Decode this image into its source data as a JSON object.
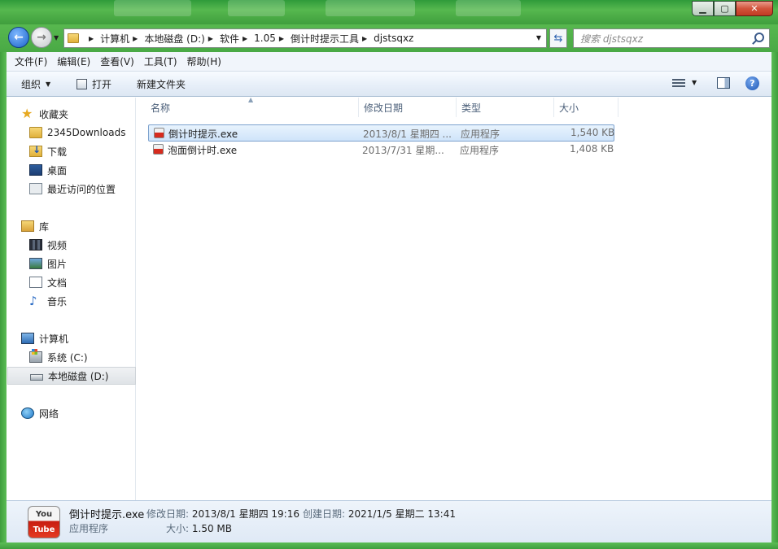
{
  "window": {
    "controls": {
      "minimize": "▁",
      "maximize": "▢",
      "close": "✕"
    }
  },
  "address": {
    "breadcrumbs": [
      "计算机",
      "本地磁盘 (D:)",
      "软件",
      "1.05",
      "倒计时提示工具",
      "djstsqxz"
    ],
    "search_placeholder": "搜索 djstsqxz"
  },
  "menu": [
    "文件(F)",
    "编辑(E)",
    "查看(V)",
    "工具(T)",
    "帮助(H)"
  ],
  "commands": {
    "organize": "组织",
    "open": "打开",
    "new_folder": "新建文件夹",
    "help": "?"
  },
  "nav": {
    "favorites": {
      "label": "收藏夹",
      "items": [
        "2345Downloads",
        "下载",
        "桌面",
        "最近访问的位置"
      ]
    },
    "libraries": {
      "label": "库",
      "items": [
        "视频",
        "图片",
        "文档",
        "音乐"
      ]
    },
    "computer": {
      "label": "计算机",
      "items": [
        "系统 (C:)",
        "本地磁盘 (D:)"
      ],
      "selected": "本地磁盘 (D:)"
    },
    "network": {
      "label": "网络"
    }
  },
  "columns": {
    "name": "名称",
    "modified": "修改日期",
    "type": "类型",
    "size": "大小"
  },
  "files": [
    {
      "name": "倒计时提示.exe",
      "modified": "2013/8/1 星期四 ...",
      "type": "应用程序",
      "size": "1,540 KB",
      "selected": true,
      "icon": "youtube-exe-icon"
    },
    {
      "name": "泡面倒计时.exe",
      "modified": "2013/7/31 星期...",
      "type": "应用程序",
      "size": "1,408 KB",
      "selected": false,
      "icon": "youtube-exe-icon"
    }
  ],
  "details": {
    "icon_text_top": "You",
    "icon_text_bottom": "Tube",
    "name": "倒计时提示.exe",
    "type": "应用程序",
    "modified_label": "修改日期:",
    "modified_value": "2013/8/1 星期四 19:16",
    "created_label": "创建日期:",
    "created_value": "2021/1/5 星期二 13:41",
    "size_label": "大小:",
    "size_value": "1.50 MB"
  },
  "colors": {
    "frame": "#4aa944",
    "selection": "#cfe4fa",
    "close_button": "#c13a22"
  }
}
